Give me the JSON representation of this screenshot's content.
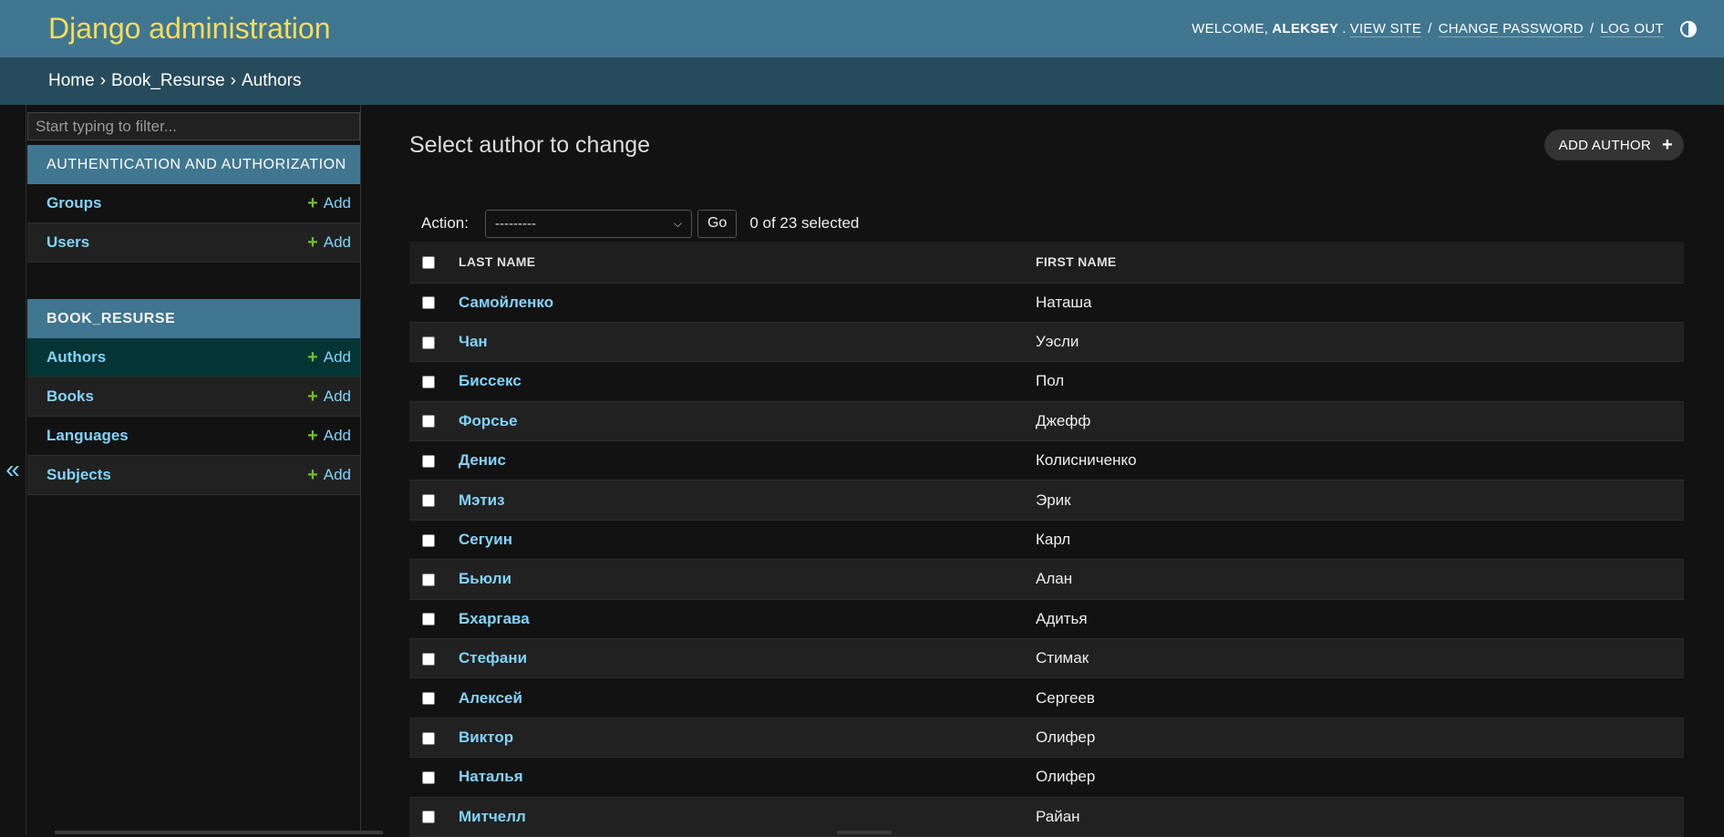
{
  "header": {
    "branding": "Django administration",
    "welcome": "WELCOME,",
    "username": "ALEKSEY",
    "view_site": "VIEW SITE",
    "change_password": "CHANGE PASSWORD",
    "log_out": "LOG OUT",
    "separator": "/"
  },
  "breadcrumbs": {
    "home": "Home",
    "app": "Book_Resurse",
    "current": "Authors",
    "sep": "›"
  },
  "sidebar": {
    "filter_placeholder": "Start typing to filter...",
    "collapse_glyph": "«",
    "apps": [
      {
        "caption": "AUTHENTICATION AND AUTHORIZATION",
        "models": [
          {
            "name": "Groups",
            "add": "Add"
          },
          {
            "name": "Users",
            "add": "Add"
          }
        ]
      },
      {
        "caption": "BOOK_RESURSE",
        "models": [
          {
            "name": "Authors",
            "add": "Add"
          },
          {
            "name": "Books",
            "add": "Add"
          },
          {
            "name": "Languages",
            "add": "Add"
          },
          {
            "name": "Subjects",
            "add": "Add"
          }
        ]
      }
    ]
  },
  "content": {
    "title": "Select author to change",
    "add_button": "ADD AUTHOR",
    "action_label": "Action:",
    "action_value": "---------",
    "go": "Go",
    "selected": "0 of 23 selected",
    "columns": [
      "LAST NAME",
      "FIRST NAME"
    ],
    "rows": [
      {
        "last": "Самойленко",
        "first": "Наташа"
      },
      {
        "last": "Чан",
        "first": "Уэсли"
      },
      {
        "last": "Биссекс",
        "first": "Пол"
      },
      {
        "last": "Форсье",
        "first": "Джефф"
      },
      {
        "last": "Денис",
        "first": "Колисниченко"
      },
      {
        "last": "Мэтиз",
        "first": "Эрик"
      },
      {
        "last": "Сегуин",
        "first": "Карл"
      },
      {
        "last": "Бьюли",
        "first": "Алан"
      },
      {
        "last": "Бхаргава",
        "first": "Адитья"
      },
      {
        "last": "Стефани",
        "first": "Стимак"
      },
      {
        "last": "Алексей",
        "first": "Сергеев"
      },
      {
        "last": "Виктор",
        "first": "Олифер"
      },
      {
        "last": "Наталья",
        "first": "Олифер"
      },
      {
        "last": "Митчелл",
        "first": "Райан"
      }
    ]
  },
  "colors": {
    "header_bg": "#417690",
    "breadcrumb_bg": "#264b5d",
    "branding": "#f5dd5d",
    "link": "#81d4fa",
    "add_plus": "#70bf2b",
    "selected_nav": "#053435"
  }
}
